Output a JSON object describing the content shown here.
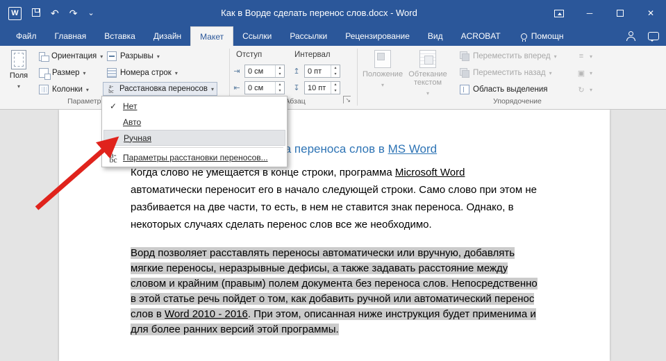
{
  "window": {
    "title": "Как в Ворде сделать перенос слов.docx - Word"
  },
  "icons": {
    "word_logo": "W",
    "check": "✓",
    "undo": "↶",
    "redo": "↷",
    "customize": "⌄",
    "minimize": "─",
    "close": "✕",
    "spin_up": "▴",
    "spin_down": "▾",
    "indent_left_icon": "⇥",
    "indent_right_icon": "⇤",
    "spacing_before_icon": "↥",
    "spacing_after_icon": "↧",
    "align": "≡",
    "group": "▣",
    "rotate": "↻",
    "dialog_launcher": "↘",
    "hyphen_top": "a-",
    "hyphen_bottom": "bc"
  },
  "tabs": {
    "items": [
      "Файл",
      "Главная",
      "Вставка",
      "Дизайн",
      "Макет",
      "Ссылки",
      "Рассылки",
      "Рецензирование",
      "Вид",
      "ACROBAT"
    ],
    "active": "Макет",
    "tell_me": "Помощн"
  },
  "ribbon": {
    "page_setup": {
      "margins": "Поля",
      "orientation": "Ориентация",
      "size": "Размер",
      "columns": "Колонки",
      "breaks": "Разрывы",
      "line_numbers": "Номера строк",
      "hyphenation": "Расстановка переносов",
      "group_label": "Параметры страницы"
    },
    "paragraph": {
      "indent_label": "Отступ",
      "spacing_label": "Интервал",
      "indent_left": "0 см",
      "indent_right": "0 см",
      "spacing_before": "0 пт",
      "spacing_after": "10 пт",
      "group_label": "Абзац"
    },
    "arrange": {
      "position": "Положение",
      "wrap_text": "Обтекание текстом",
      "bring_forward": "Переместить вперед",
      "send_backward": "Переместить назад",
      "selection_pane": "Область выделения",
      "group_label": "Упорядочение"
    }
  },
  "menu": {
    "items": [
      {
        "label": "Нет",
        "checked": true,
        "highlighted": false
      },
      {
        "label": "Авто",
        "checked": false,
        "highlighted": false
      },
      {
        "label": "Ручная",
        "checked": false,
        "highlighted": true
      },
      {
        "label": "Параметры расстановки переносов...",
        "checked": false,
        "highlighted": false
      }
    ]
  },
  "document": {
    "heading": {
      "start": "Автоматическая расстановка переноса слов в ",
      "emphasis": "MS Word"
    },
    "paragraph1": {
      "before": "Когда слово не умещается в конце строки, программа ",
      "underlined": "Microsoft Word",
      "after": " автоматически переносит его в начало следующей строки. Само слово при этом не разбивается на две части, то есть, в нем не ставится знак переноса. Однако, в некоторых случаях сделать перенос слов все же необходимо."
    },
    "paragraph2": {
      "before": "Ворд позволяет расставлять переносы автоматически или вручную, добавлять мягкие переносы, неразрывные дефисы, а также задавать расстояние между словом и крайним (правым) полем документа без переноса слов. Непосредственно в этой статье речь пойдет о том, как добавить ручной или автоматический перенос слов в ",
      "underlined": "Word 2010 - 2016",
      "after": ". При этом, описанная ниже инструкция будет применима и для более ранних версий этой программы."
    }
  },
  "colors": {
    "titlebar": "#2b579a",
    "heading": "#2e74b5",
    "selection": "#cbcbcb",
    "arrow": "#e0231c"
  }
}
